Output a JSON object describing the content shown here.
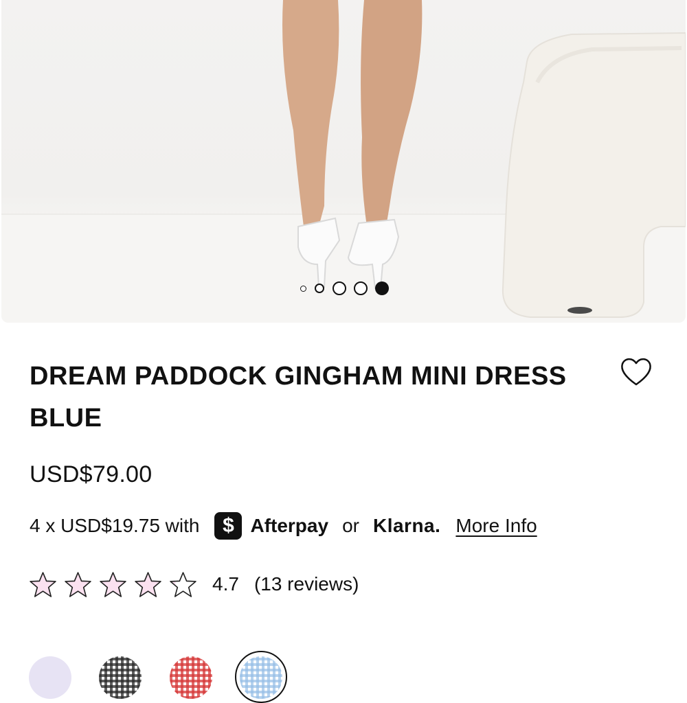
{
  "gallery": {
    "image_description_icon": "product-photo",
    "dot_count": 5,
    "active_dot_index": 4
  },
  "product": {
    "title": "DREAM PADDOCK GINGHAM MINI DRESS BLUE",
    "price": "USD$79.00",
    "wishlist_icon": "heart-outline-icon"
  },
  "payments": {
    "installment_text": "4 x USD$19.75 with",
    "afterpay_symbol": "$",
    "afterpay_label": "Afterpay",
    "or_text": "or",
    "klarna_label": "Klarna.",
    "more_info_label": "More Info"
  },
  "rating": {
    "value": "4.7",
    "reviews_label": "(13 reviews)",
    "stars_filled_fraction": 0.94
  },
  "swatches": [
    {
      "name": "lilac",
      "color": "#e7e3f4"
    },
    {
      "name": "black-gingham",
      "color": "#3a3a3a"
    },
    {
      "name": "red-gingham",
      "color": "#d9413f"
    },
    {
      "name": "blue-gingham",
      "color": "#a9c8e8",
      "selected": true
    }
  ],
  "colors": {
    "text": "#111111",
    "star_fill": "#fbe1f0",
    "star_stroke": "#222222"
  }
}
